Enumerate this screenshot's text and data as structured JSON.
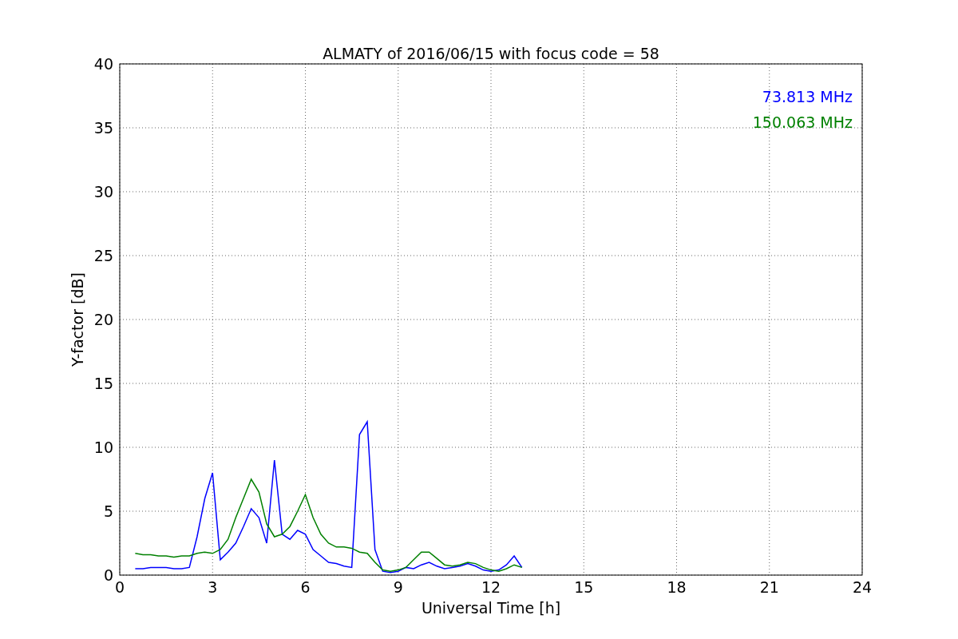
{
  "chart_data": {
    "type": "line",
    "title": "ALMATY of 2016/06/15 with focus code = 58",
    "xlabel": "Universal Time [h]",
    "ylabel": "Y-factor [dB]",
    "x": [
      0.5,
      0.75,
      1.0,
      1.25,
      1.5,
      1.75,
      2.0,
      2.25,
      2.5,
      2.75,
      3.0,
      3.25,
      3.5,
      3.75,
      4.0,
      4.25,
      4.5,
      4.75,
      5.0,
      5.25,
      5.5,
      5.75,
      6.0,
      6.25,
      6.5,
      6.75,
      7.0,
      7.25,
      7.5,
      7.75,
      8.0,
      8.25,
      8.5,
      8.75,
      9.0,
      9.25,
      9.5,
      9.75,
      10.0,
      10.25,
      10.5,
      10.75,
      11.0,
      11.25,
      11.5,
      11.75,
      12.0,
      12.25,
      12.5,
      12.75,
      13.0
    ],
    "series": [
      {
        "name": "73.813 MHz",
        "color": "#0000ff",
        "values": [
          0.5,
          0.5,
          0.6,
          0.6,
          0.6,
          0.5,
          0.5,
          0.6,
          3,
          6,
          8,
          1.2,
          1.8,
          2.5,
          3.8,
          5.2,
          4.5,
          2.5,
          9,
          3.2,
          2.8,
          3.5,
          3.2,
          2.0,
          1.5,
          1.0,
          0.9,
          0.7,
          0.6,
          11,
          12,
          2,
          0.3,
          0.2,
          0.3,
          0.6,
          0.5,
          0.8,
          1.0,
          0.7,
          0.5,
          0.6,
          0.7,
          0.9,
          0.7,
          0.4,
          0.3,
          0.4,
          0.8,
          1.5,
          0.6
        ]
      },
      {
        "name": "150.063 MHz",
        "color": "#008000",
        "values": [
          1.7,
          1.6,
          1.6,
          1.5,
          1.5,
          1.4,
          1.5,
          1.5,
          1.7,
          1.8,
          1.7,
          2.0,
          2.8,
          4.5,
          6,
          7.5,
          6.5,
          4,
          3,
          3.2,
          3.8,
          5,
          6.3,
          4.5,
          3.2,
          2.5,
          2.2,
          2.2,
          2.1,
          1.8,
          1.7,
          1.0,
          0.4,
          0.3,
          0.4,
          0.6,
          1.2,
          1.8,
          1.8,
          1.3,
          0.8,
          0.7,
          0.8,
          1.0,
          0.9,
          0.6,
          0.4,
          0.3,
          0.5,
          0.8,
          0.6
        ]
      }
    ],
    "xlim": [
      0,
      24
    ],
    "ylim": [
      0,
      40
    ],
    "xticks": [
      0,
      3,
      6,
      9,
      12,
      15,
      18,
      21,
      24
    ],
    "yticks": [
      0,
      5,
      10,
      15,
      20,
      25,
      30,
      35,
      40
    ],
    "grid": true
  }
}
